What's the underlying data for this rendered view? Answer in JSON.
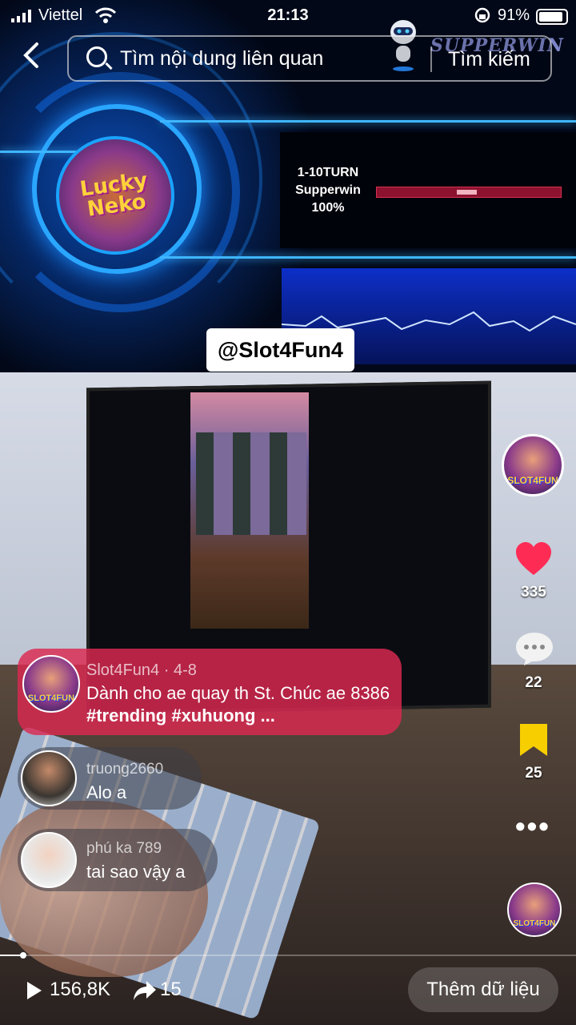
{
  "status_bar": {
    "carrier": "Viettel",
    "time": "21:13",
    "battery_percent": "91%",
    "battery_level": 0.91
  },
  "search": {
    "placeholder": "Tìm nội dung liên quan",
    "button_label": "Tìm kiếm"
  },
  "video": {
    "banner_brand": "SUPPERWIN",
    "game_logo": "Lucky Neko",
    "turn_text_line1": "1-10TURN",
    "turn_text_line2": "Supperwin",
    "turn_text_line3": "100%",
    "watermark": "@Slot4Fun4",
    "progress_fraction": 0.04
  },
  "creator": {
    "avatar_label": "SLOT4FUN"
  },
  "actions": {
    "likes": "335",
    "comments": "22",
    "saves": "25",
    "more_icon": "more-dots-icon",
    "like_color": "#fe2c55",
    "save_color": "#f7ce00"
  },
  "caption": {
    "author": "Slot4Fun4",
    "date": "4-8",
    "meta": "Slot4Fun4 · 4-8",
    "text": "Dành cho ae quay th St. Chúc ae 8386",
    "tags": "#trending #xuhuong ..."
  },
  "comments": [
    {
      "user": "truong2660",
      "text": "Alo a"
    },
    {
      "user": "phú ka 789",
      "text": "tai sao vậy a"
    }
  ],
  "bottom": {
    "views": "156,8K",
    "shares": "15",
    "more_data_button": "Thêm dữ liệu"
  }
}
